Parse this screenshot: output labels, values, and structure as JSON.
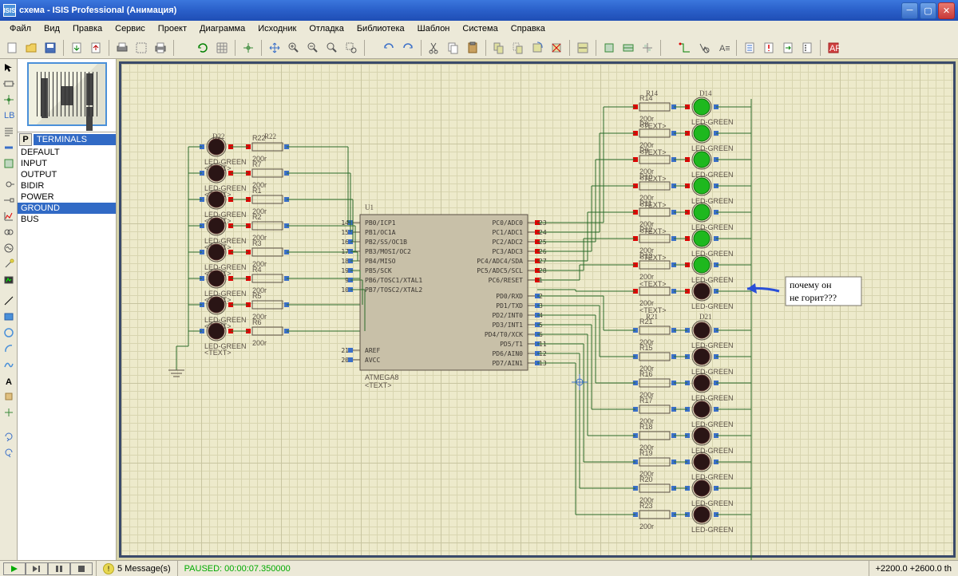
{
  "title": "схема - ISIS Professional (Анимация)",
  "menus": [
    "Файл",
    "Вид",
    "Правка",
    "Сервис",
    "Проект",
    "Диаграмма",
    "Исходник",
    "Отладка",
    "Библиотека",
    "Шаблон",
    "Система",
    "Справка"
  ],
  "terminals": {
    "button": "P",
    "header": "TERMINALS",
    "items": [
      "DEFAULT",
      "INPUT",
      "OUTPUT",
      "BIDIR",
      "POWER",
      "GROUND",
      "BUS"
    ],
    "selected": "GROUND"
  },
  "chip": {
    "ref": "U1",
    "part": "ATMEGA8",
    "text": "<TEXT>",
    "left_pins": [
      {
        "num": "14",
        "name": "PB0/ICP1"
      },
      {
        "num": "15",
        "name": "PB1/OC1A"
      },
      {
        "num": "16",
        "name": "PB2/SS/OC1B"
      },
      {
        "num": "17",
        "name": "PB3/MOSI/OC2"
      },
      {
        "num": "18",
        "name": "PB4/MISO"
      },
      {
        "num": "19",
        "name": "PB5/SCK"
      },
      {
        "num": "9",
        "name": "PB6/TOSC1/XTAL1"
      },
      {
        "num": "10",
        "name": "PB7/TOSC2/XTAL2"
      }
    ],
    "left_pins2": [
      {
        "num": "21",
        "name": "AREF"
      },
      {
        "num": "20",
        "name": "AVCC"
      }
    ],
    "right_pins": [
      {
        "num": "23",
        "name": "PC0/ADC0"
      },
      {
        "num": "24",
        "name": "PC1/ADC1"
      },
      {
        "num": "25",
        "name": "PC2/ADC2"
      },
      {
        "num": "26",
        "name": "PC3/ADC3"
      },
      {
        "num": "27",
        "name": "PC4/ADC4/SDA"
      },
      {
        "num": "28",
        "name": "PC5/ADC5/SCL"
      },
      {
        "num": "1",
        "name": "PC6/RESET"
      }
    ],
    "right_pins2": [
      {
        "num": "2",
        "name": "PD0/RXD"
      },
      {
        "num": "3",
        "name": "PD1/TXD"
      },
      {
        "num": "4",
        "name": "PD2/INT0"
      },
      {
        "num": "5",
        "name": "PD3/INT1"
      },
      {
        "num": "6",
        "name": "PD4/T0/XCK"
      },
      {
        "num": "11",
        "name": "PD5/T1"
      },
      {
        "num": "12",
        "name": "PD6/AIN0"
      },
      {
        "num": "13",
        "name": "PD7/AIN1"
      }
    ]
  },
  "left_group": {
    "d_label": "D22",
    "r_label": "R22",
    "rows": [
      {
        "r": "R22",
        "v": "200r"
      },
      {
        "r": "R7",
        "v": "200r"
      },
      {
        "r": "R1",
        "v": "200r"
      },
      {
        "r": "R2",
        "v": "200r"
      },
      {
        "r": "R3",
        "v": "200r"
      },
      {
        "r": "R4",
        "v": "200r"
      },
      {
        "r": "R5",
        "v": "200r"
      },
      {
        "r": "R6",
        "v": "200r"
      }
    ],
    "led_label": "LED-GREEN",
    "text": "<TEXT>"
  },
  "right_top": {
    "d_label": "D14",
    "r_start": "R14",
    "rows": [
      {
        "r": "R14",
        "v": "200r",
        "on": true
      },
      {
        "r": "R8",
        "v": "200r",
        "on": true
      },
      {
        "r": "R9",
        "v": "200r",
        "on": true
      },
      {
        "r": "R10",
        "v": "200r",
        "on": true
      },
      {
        "r": "R11",
        "v": "200r",
        "on": true
      },
      {
        "r": "R12",
        "v": "200r",
        "on": true
      },
      {
        "r": "R13",
        "v": "200r",
        "on": true
      },
      {
        "r": "",
        "v": "200r",
        "on": false
      }
    ],
    "led_label": "LED-GREEN",
    "text": "<TEXT>"
  },
  "right_bot": {
    "d_label": "D21",
    "r_start": "R21",
    "rows": [
      {
        "r": "R21",
        "v": "200r"
      },
      {
        "r": "R15",
        "v": "200r"
      },
      {
        "r": "R16",
        "v": "200r"
      },
      {
        "r": "R17",
        "v": "200r"
      },
      {
        "r": "R18",
        "v": "200r"
      },
      {
        "r": "R19",
        "v": "200r"
      },
      {
        "r": "R20",
        "v": "200r"
      },
      {
        "r": "R23",
        "v": "200r"
      }
    ],
    "led_label": "LED-GREEN",
    "text": "<TEXT>"
  },
  "annotation": {
    "line1": "почему он",
    "line2": "не горит???"
  },
  "status": {
    "messages": "5 Message(s)",
    "sim_state": "PAUSED: 00:00:07.350000",
    "coords": "+2200.0    +2600.0    th"
  }
}
